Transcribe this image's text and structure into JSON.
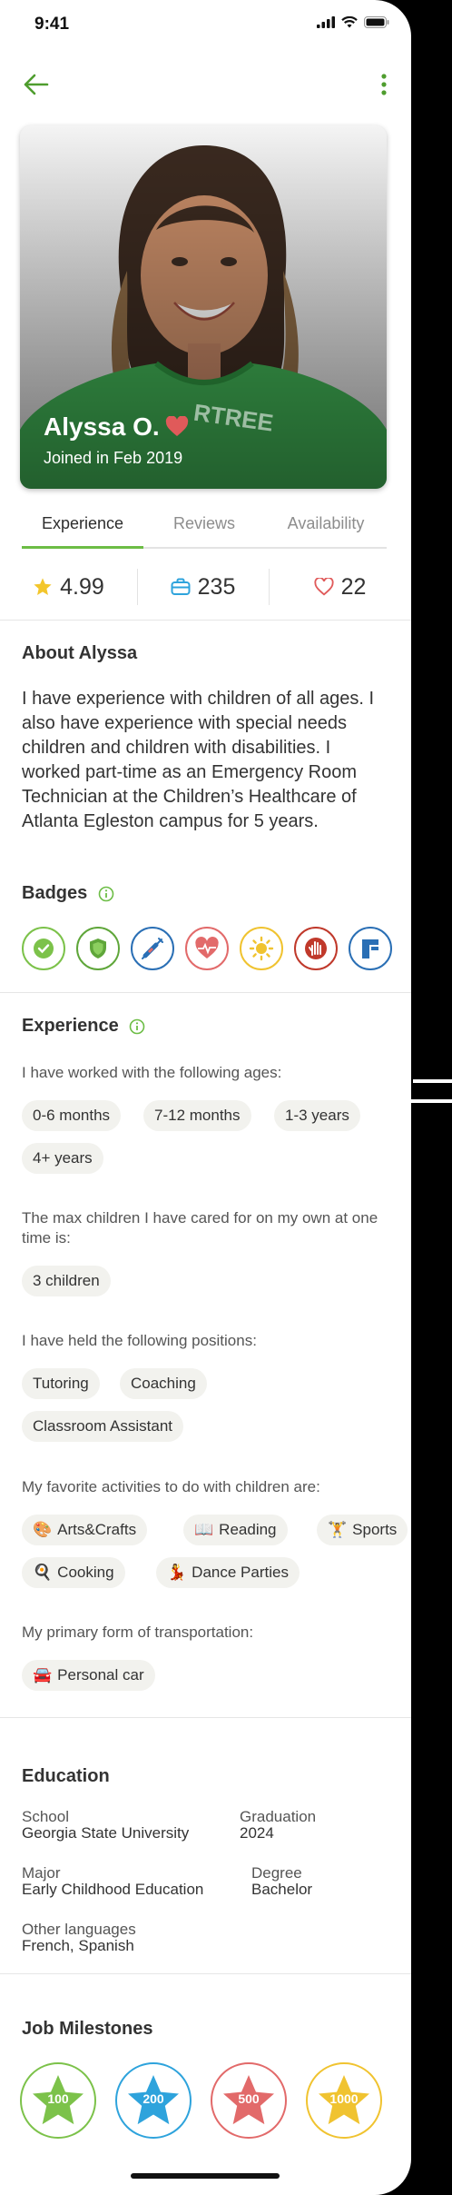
{
  "status_bar": {
    "time": "9:41"
  },
  "profile": {
    "name": "Alyssa O.",
    "joined": "Joined in Feb 2019",
    "shirt_text": "RTREE"
  },
  "tabs": [
    {
      "label": "Experience",
      "active": true
    },
    {
      "label": "Reviews",
      "active": false
    },
    {
      "label": "Availability",
      "active": false
    }
  ],
  "stats": {
    "rating": "4.99",
    "jobs": "235",
    "favorites": "22"
  },
  "about": {
    "title": "About Alyssa",
    "text": "I have experience with children of all ages. I also have experience with special needs children and children with disabilities. I worked part-time as an Emergency Room Technician at the Children’s Healthcare of Atlanta Egleston campus for 5 years."
  },
  "badges": {
    "title": "Badges",
    "items": [
      {
        "icon": "shield-check-icon",
        "color": "#7cc24a"
      },
      {
        "icon": "shield-icon",
        "color": "#5fa63a"
      },
      {
        "icon": "syringe-icon",
        "color": "#2a6fb5"
      },
      {
        "icon": "heartbeat-icon",
        "color": "#e26a6a"
      },
      {
        "icon": "sun-icon",
        "color": "#f0c330"
      },
      {
        "icon": "hand-icon",
        "color": "#c0392b"
      },
      {
        "icon": "bookmark-icon",
        "color": "#2a6fb5"
      }
    ]
  },
  "experience": {
    "title": "Experience",
    "ages_label": "I have worked with the following ages:",
    "ages": [
      "0-6 months",
      "7-12 months",
      "1-3 years",
      "4+ years"
    ],
    "max_children_label": "The max children I have cared for on my own at one time is:",
    "max_children": "3 children",
    "positions_label": "I have held the following positions:",
    "positions": [
      "Tutoring",
      "Coaching",
      "Classroom Assistant"
    ],
    "activities_label": "My favorite activities to do with children are:",
    "activities": [
      {
        "icon": "palette-icon",
        "label": "Arts&Crafts"
      },
      {
        "icon": "book-icon",
        "label": "Reading"
      },
      {
        "icon": "weightlifter-icon",
        "label": "Sports"
      },
      {
        "icon": "frying-pan-icon",
        "label": "Cooking"
      },
      {
        "icon": "dancer-icon",
        "label": "Dance Parties"
      }
    ],
    "transport_label": "My primary form of transportation:",
    "transport": {
      "icon": "car-icon",
      "label": "Personal car"
    }
  },
  "education": {
    "title": "Education",
    "school_label": "School",
    "school": "Georgia State University",
    "graduation_label": "Graduation",
    "graduation": "2024",
    "major_label": "Major",
    "major": "Early Childhood Education",
    "degree_label": "Degree",
    "degree": "Bachelor",
    "languages_label": "Other languages",
    "languages": "French, Spanish"
  },
  "milestones": {
    "title": "Job Milestones",
    "items": [
      {
        "value": "100",
        "color": "#7cc24a"
      },
      {
        "value": "200",
        "color": "#2ea3dc"
      },
      {
        "value": "500",
        "color": "#e26a6a"
      },
      {
        "value": "1000",
        "color": "#f0c330"
      }
    ]
  },
  "colors": {
    "accent": "#6cbd45",
    "heart": "#e05a5a",
    "star": "#f3c62c",
    "jobs": "#2ea3dc"
  }
}
